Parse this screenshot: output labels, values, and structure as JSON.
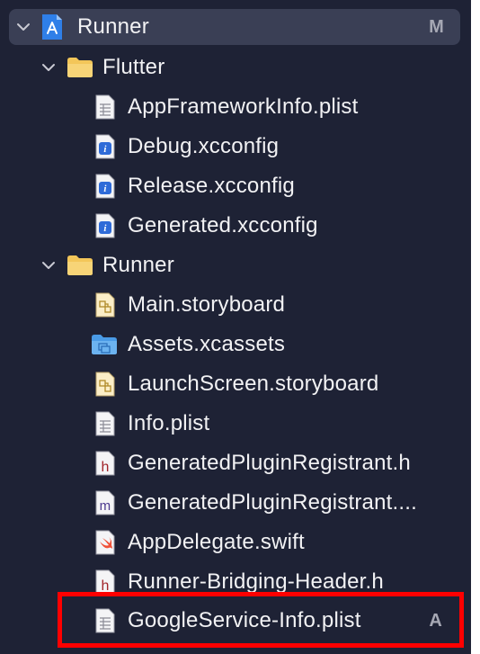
{
  "navigator": {
    "root": {
      "label": "Runner",
      "badge": "M",
      "icon": "xcode-project-icon",
      "chevron": "chevron-down-icon"
    },
    "groups": [
      {
        "label": "Flutter",
        "icon": "folder-icon",
        "files": [
          {
            "label": "AppFrameworkInfo.plist",
            "icon": "plist-file-icon"
          },
          {
            "label": "Debug.xcconfig",
            "icon": "xcconfig-file-icon"
          },
          {
            "label": "Release.xcconfig",
            "icon": "xcconfig-file-icon"
          },
          {
            "label": "Generated.xcconfig",
            "icon": "xcconfig-file-icon"
          }
        ]
      },
      {
        "label": "Runner",
        "icon": "folder-icon",
        "files": [
          {
            "label": "Main.storyboard",
            "icon": "storyboard-file-icon"
          },
          {
            "label": "Assets.xcassets",
            "icon": "asset-catalog-folder-icon"
          },
          {
            "label": "LaunchScreen.storyboard",
            "icon": "storyboard-file-icon"
          },
          {
            "label": "Info.plist",
            "icon": "plist-file-icon"
          },
          {
            "label": "GeneratedPluginRegistrant.h",
            "icon": "header-file-icon"
          },
          {
            "label": "GeneratedPluginRegistrant....",
            "icon": "objc-file-icon"
          },
          {
            "label": "AppDelegate.swift",
            "icon": "swift-file-icon"
          },
          {
            "label": "Runner-Bridging-Header.h",
            "icon": "header-file-icon"
          },
          {
            "label": "GoogleService-Info.plist",
            "icon": "plist-file-icon",
            "badge": "A"
          }
        ]
      }
    ]
  },
  "colors": {
    "background": "#1e2235",
    "selected_row": "#3a3f55",
    "highlight": "#ff0000",
    "folder": "#f3c659",
    "xcconfig": "#2f6bd8",
    "swift": "#f05138"
  }
}
